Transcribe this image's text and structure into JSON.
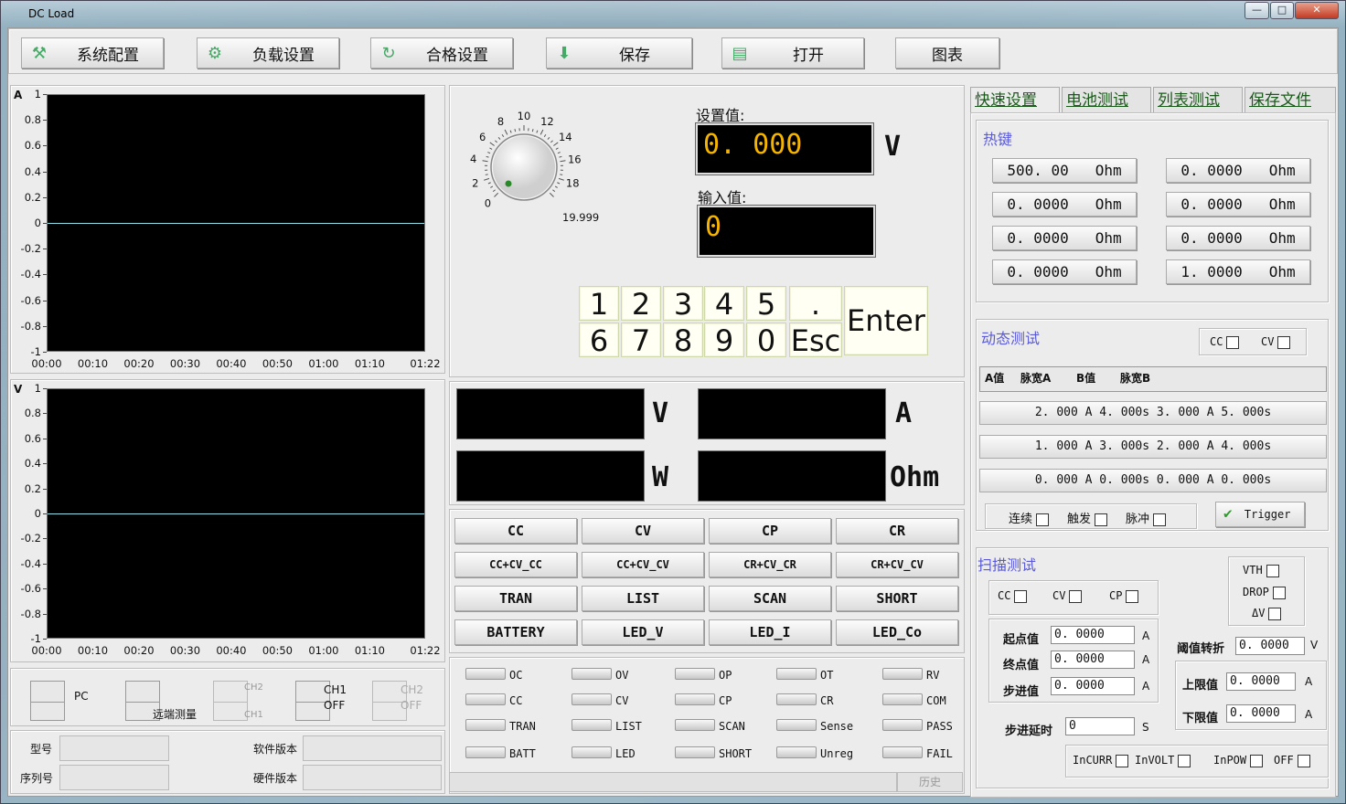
{
  "window": {
    "title": "DC Load",
    "min": "—",
    "max": "□",
    "close": "✕"
  },
  "toolbar": [
    {
      "label": "系统配置",
      "icon": "wrench-icon",
      "glyph": "⚒"
    },
    {
      "label": "负载设置",
      "icon": "gear-icon",
      "glyph": "⚙"
    },
    {
      "label": "合格设置",
      "icon": "refresh-arrow-icon",
      "glyph": "↻"
    },
    {
      "label": "保存",
      "icon": "save-icon",
      "glyph": "⬇"
    },
    {
      "label": "打开",
      "icon": "open-file-icon",
      "glyph": "▤"
    },
    {
      "label": "图表",
      "icon": "",
      "glyph": ""
    }
  ],
  "chart_data": [
    {
      "type": "line",
      "axis_name": "A",
      "ylim": [
        -1,
        1
      ],
      "yticks": [
        "1",
        "0.8",
        "0.6",
        "0.4",
        "0.2",
        "0",
        "-0.2",
        "-0.4",
        "-0.6",
        "-0.8",
        "-1"
      ],
      "xticks": [
        "00:00",
        "00:10",
        "00:20",
        "00:30",
        "00:40",
        "00:50",
        "01:00",
        "01:10",
        "01:22"
      ],
      "series": [
        {
          "x": [
            "00:00",
            "01:22"
          ],
          "y": [
            0,
            0
          ]
        }
      ],
      "color": "#8fe0e8"
    },
    {
      "type": "line",
      "axis_name": "V",
      "ylim": [
        -1,
        1
      ],
      "yticks": [
        "1",
        "0.8",
        "0.6",
        "0.4",
        "0.2",
        "0",
        "-0.2",
        "-0.4",
        "-0.6",
        "-0.8",
        "-1"
      ],
      "xticks": [
        "00:00",
        "00:10",
        "00:20",
        "00:30",
        "00:40",
        "00:50",
        "01:00",
        "01:10",
        "01:22"
      ],
      "series": [
        {
          "x": [
            "00:00",
            "01:22"
          ],
          "y": [
            0,
            0
          ]
        }
      ],
      "color": "#8fe0e8"
    }
  ],
  "status_switches": {
    "pc": "PC",
    "remote": "远端测量",
    "ch2a": "CH2",
    "ch1a": "CH1",
    "ch1": "CH1",
    "ch1_state": "OFF",
    "ch2": "CH2",
    "ch2_state": "OFF"
  },
  "info": {
    "model_label": "型号",
    "sw_label": "软件版本",
    "serial_label": "序列号",
    "hw_label": "硬件版本"
  },
  "knob": {
    "ticks": [
      "0",
      "2",
      "4",
      "6",
      "8",
      "10",
      "12",
      "14",
      "16",
      "18"
    ],
    "max": "19.999"
  },
  "setpoint": {
    "label": "设置值:",
    "value": "0. 000",
    "unit": "V"
  },
  "input": {
    "label": "输入值:",
    "value": "0"
  },
  "keypad": {
    "row1": [
      "1",
      "2",
      "3",
      "4",
      "5",
      "."
    ],
    "row2": [
      "6",
      "7",
      "8",
      "9",
      "0",
      "Esc"
    ],
    "enter": "Enter"
  },
  "meters": {
    "v": "V",
    "a": "A",
    "w": "W",
    "ohm": "Ohm"
  },
  "modes": [
    [
      "CC",
      "CV",
      "CP",
      "CR"
    ],
    [
      "CC+CV_CC",
      "CC+CV_CV",
      "CR+CV_CR",
      "CR+CV_CV"
    ],
    [
      "TRAN",
      "LIST",
      "SCAN",
      "SHORT"
    ],
    [
      "BATTERY",
      "LED_V",
      "LED_I",
      "LED_Co"
    ]
  ],
  "leds": [
    [
      "OC",
      "OV",
      "OP",
      "OT",
      "RV"
    ],
    [
      "CC",
      "CV",
      "CP",
      "CR",
      "COM"
    ],
    [
      "TRAN",
      "LIST",
      "SCAN",
      "Sense",
      "PASS"
    ],
    [
      "BATT",
      "LED",
      "SHORT",
      "Unreg",
      "FAIL"
    ]
  ],
  "history": "历史",
  "tabs": [
    "快速设置",
    "电池测试",
    "列表测试",
    "保存文件"
  ],
  "hotkeys": {
    "title": "热键",
    "items": [
      "500. 00   Ohm",
      "0. 0000   Ohm",
      "0. 0000   Ohm",
      "0. 0000   Ohm",
      "0. 0000   Ohm",
      "0. 0000   Ohm",
      "0. 0000   Ohm",
      "1. 0000   Ohm"
    ]
  },
  "dynamic": {
    "title": "动态测试",
    "cc": "CC",
    "cv": "CV",
    "headers": [
      "A值",
      "脉宽A",
      "B值",
      "脉宽B"
    ],
    "rows": [
      "2. 000  A  4. 000s  3. 000  A  5. 000s",
      "1. 000  A  3. 000s  2. 000  A  4. 000s",
      "0. 000  A  0. 000s  0. 000  A  0. 000s"
    ],
    "modes": [
      "连续",
      "触发",
      "脉冲"
    ],
    "trigger": "Trigger"
  },
  "scan": {
    "title": "扫描测试",
    "cc": "CC",
    "cv": "CV",
    "cp": "CP",
    "vth": "VTH",
    "drop": "DROP",
    "dv": "ΔV",
    "start_label": "起点值",
    "start": "0. 0000",
    "end_label": "终点值",
    "end": "0. 0000",
    "step_label": "步进值",
    "step": "0. 0000",
    "unit_a": "A",
    "delay_label": "步进延时",
    "delay": "0",
    "delay_unit": "S",
    "thresh_label": "阈值转折",
    "thresh": "0. 0000",
    "thresh_unit": "V",
    "upper_label": "上限值",
    "upper": "0. 0000",
    "lower_label": "下限值",
    "lower": "0. 0000",
    "bottom": [
      "InCURR",
      "InVOLT",
      "InPOW",
      "OFF"
    ]
  }
}
